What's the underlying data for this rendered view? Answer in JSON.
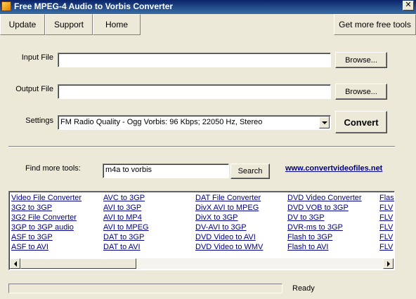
{
  "window": {
    "title": "Free MPEG-4 Audio to Vorbis Converter",
    "close_glyph": "✕"
  },
  "menu": {
    "update": "Update",
    "support": "Support",
    "home": "Home",
    "more_tools": "Get more free tools"
  },
  "form": {
    "input_label": "Input File",
    "input_value": "",
    "output_label": "Output File",
    "output_value": "",
    "browse_label": "Browse...",
    "settings_label": "Settings",
    "settings_value": "FM Radio Quality - Ogg Vorbis: 96 Kbps; 22050 Hz, Stereo",
    "convert_label": "Convert"
  },
  "tools": {
    "find_label": "Find more tools:",
    "search_value": "m4a to vorbis",
    "search_button": "Search",
    "website": "www.convertvideofiles.net",
    "columns": [
      [
        "Video File Converter",
        "3G2 to 3GP",
        "3G2 File Converter",
        "3GP to 3GP audio",
        "ASF to 3GP",
        "ASF to AVI"
      ],
      [
        "AVC to 3GP",
        "AVI to 3GP",
        "AVI to MP4",
        "AVI to MPEG",
        "DAT to 3GP",
        "DAT to AVI"
      ],
      [
        "DAT File Converter",
        "DivX AVI to MPEG",
        "DivX to 3GP",
        "DV-AVI to 3GP",
        "DVD Video to AVI",
        "DVD Video to WMV"
      ],
      [
        "DVD Video Converter",
        "DVD VOB to 3GP",
        "DV to 3GP",
        "DVR-ms to 3GP",
        "Flash to 3GP",
        "Flash to AVI"
      ],
      [
        "Flasl",
        "FLV",
        "FLV",
        "FLV",
        "FLV",
        "FLV"
      ]
    ]
  },
  "status": {
    "text": "Ready",
    "progress_fraction": 0.0
  },
  "colors": {
    "title_start": "#0a246a",
    "title_end": "#3a6ea5",
    "link": "#00008b",
    "face": "#ece9d8"
  }
}
